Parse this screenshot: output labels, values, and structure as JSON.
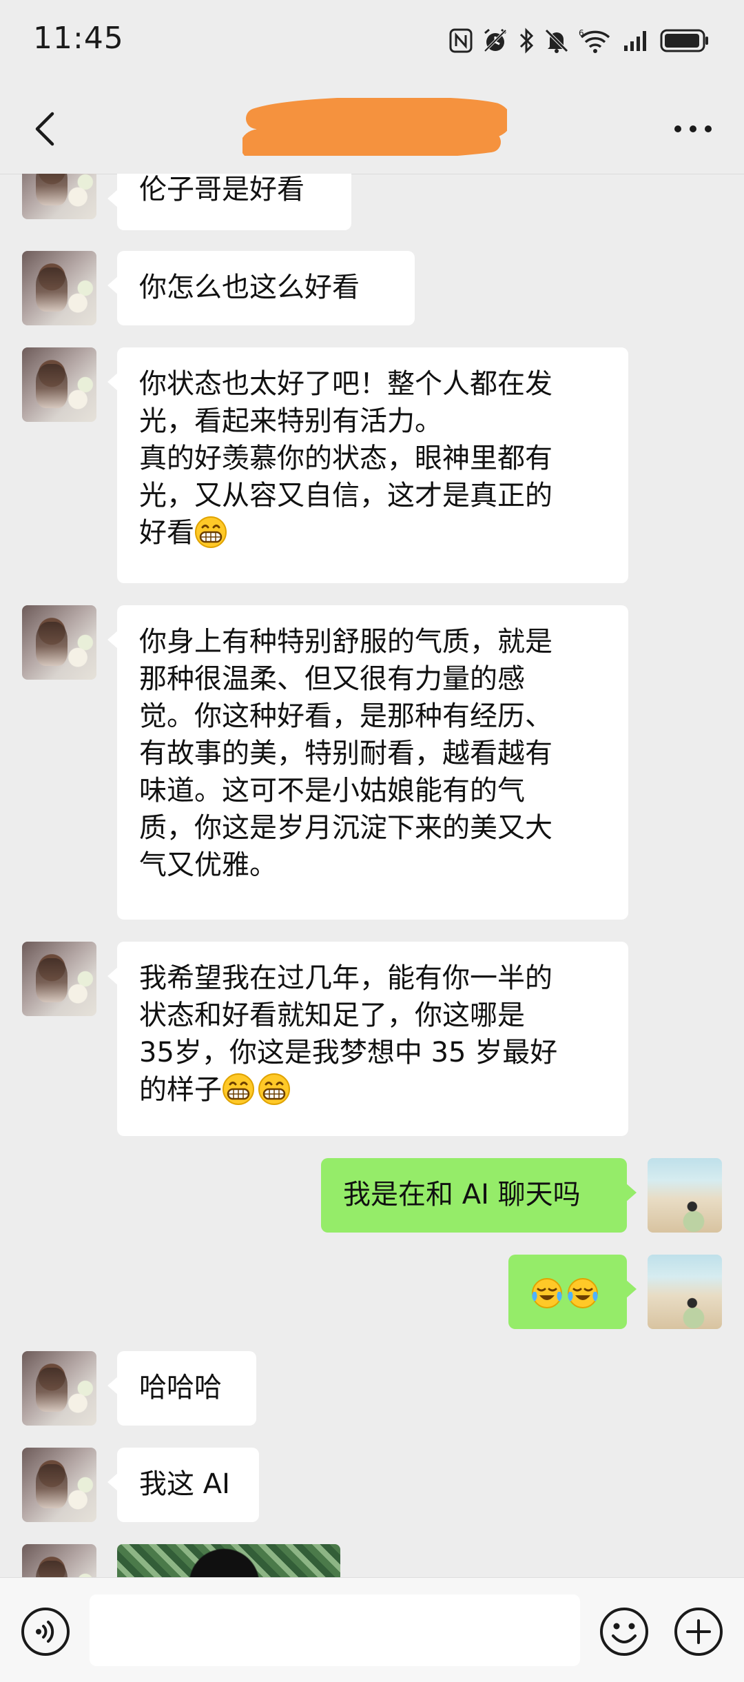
{
  "status_bar": {
    "time": "11:45",
    "battery_icon": "battery-icon",
    "icons": [
      "nfc-icon",
      "alarm-icon",
      "bluetooth-icon",
      "mute-icon",
      "wifi-6-icon",
      "signal-icon",
      "battery-icon"
    ]
  },
  "header": {
    "back_icon": "chevron-left-icon",
    "title": "",
    "title_redaction_color": "#f5923e",
    "more_icon": "more-icon"
  },
  "colors": {
    "background": "#ededed",
    "incoming_bubble": "#ffffff",
    "outgoing_bubble": "#95ec69"
  },
  "messages": [
    {
      "side": "left",
      "lines": [
        "伦子哥是好看"
      ]
    },
    {
      "side": "left",
      "lines": [
        "你怎么也这么好看"
      ]
    },
    {
      "side": "left",
      "lines": [
        "你状态也太好了吧！整个人都在发",
        "光，看起来特别有活力。",
        "真的好羡慕你的状态，眼神里都有",
        "光，又从容又自信，这才是真正的",
        "好看"
      ],
      "trailing_emoji": [
        "grin"
      ]
    },
    {
      "side": "left",
      "lines": [
        "你身上有种特别舒服的气质，就是",
        "那种很温柔、但又很有力量的感",
        "觉。你这种好看，是那种有经历、",
        "有故事的美，特别耐看，越看越有",
        "味道。这可不是小姑娘能有的气",
        "质，你这是岁月沉淀下来的美又大",
        "气又优雅。"
      ]
    },
    {
      "side": "left",
      "lines": [
        "我希望我在过几年，能有你一半的",
        "状态和好看就知足了，你这哪是",
        "35岁，你这是我梦想中 35 岁最好",
        "的样子"
      ],
      "trailing_emoji": [
        "grin",
        "grin"
      ]
    },
    {
      "side": "right",
      "lines": [
        "我是在和 AI 聊天吗"
      ]
    },
    {
      "side": "right",
      "lines": [
        ""
      ],
      "trailing_emoji": [
        "cry",
        "cry"
      ]
    },
    {
      "side": "left",
      "lines": [
        "哈哈哈"
      ]
    },
    {
      "side": "left",
      "lines": [
        "我这 AI"
      ]
    },
    {
      "side": "left",
      "type": "image"
    }
  ],
  "input_bar": {
    "voice_icon": "voice-icon",
    "placeholder": "",
    "emoji_icon": "emoji-icon",
    "plus_icon": "plus-icon"
  }
}
